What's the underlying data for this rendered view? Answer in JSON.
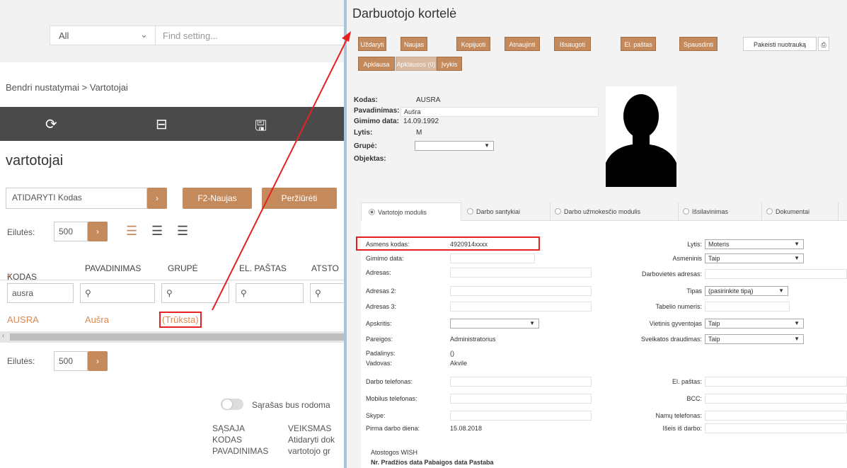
{
  "left": {
    "search": {
      "scope": "All",
      "placeholder": "Find setting..."
    },
    "breadcrumb": "Bendri nustatymai > Vartotojai",
    "page_title": "vartotojai",
    "open_field": "ATIDARYTI Kodas",
    "f2_label": "F2-Naujas",
    "view_label": "Peržiūrėti",
    "rows_label": "Eilutės:",
    "rows_value": "500",
    "columns": [
      "KODAS",
      "PAVADINIMAS",
      "GRUPĖ",
      "EL. PAŠTAS",
      "ATSTO"
    ],
    "filter_value": "ausra",
    "row": {
      "kodas": "AUSRA",
      "pavadinimas": "Aušra",
      "grupe": "(Trūksta)"
    },
    "toggle_text": "Sąrašas bus rodoma",
    "bottom": {
      "c1": [
        "SĄSAJA",
        "KODAS",
        "PAVADINIMAS"
      ],
      "c2": [
        "VEIKSMAS",
        "Atidaryti dok",
        "vartotojo gr"
      ]
    }
  },
  "right": {
    "title": "Darbuotojo kortelė",
    "buttons_row1": [
      "Uždaryti",
      "Naujas",
      "Kopijuoti",
      "Atnaujinti",
      "Išsaugoti",
      "El. paštas",
      "Spausdinti"
    ],
    "change_photo": "Pakeisti nuotrauką",
    "buttons_row2": [
      "Apklausa",
      "Apklausos (0)",
      "Įvykis"
    ],
    "info": {
      "kodas_label": "Kodas:",
      "kodas": "AUSRA",
      "pav_label": "Pavadinimas:",
      "pav": "Aušra",
      "gim_label": "Gimimo data:",
      "gim": "14.09.1992",
      "lytis_label": "Lytis:",
      "lytis": "M",
      "grupe_label": "Grupė:",
      "obj_label": "Objektas:"
    },
    "tabs": [
      "Vartotojo modulis",
      "Darbo santykiai",
      "Darbo užmokesčio modulis",
      "Išsilavinimas",
      "Dokumentai"
    ],
    "form_left": {
      "asmens_label": "Asmens kodas:",
      "asmens": "4920914xxxx",
      "gimimo": "Gimimo data:",
      "adresas": "Adresas:",
      "adresas2": "Adresas 2:",
      "adresas3": "Adresas 3:",
      "apskritis": "Apskritis:",
      "pareigos_label": "Pareigos:",
      "pareigos": "Administratorius",
      "padalinys_label": "Padalinys:",
      "padalinys": "()",
      "vadovas_label": "Vadovas:",
      "vadovas": "Akvile",
      "darbo_tel": "Darbo telefonas:",
      "mob_tel": "Mobilus telefonas:",
      "skype": "Skype:",
      "pirma_label": "Pirma darbo diena:",
      "pirma": "15.08.2018",
      "atostogos": "Atostogos WISH",
      "cols": "Nr. Pradžios data Pabaigos data Pastaba"
    },
    "form_right": {
      "lytis_label": "Lytis:",
      "lytis": "Moteris",
      "asmeninis_label": "Asmeninis",
      "asmeninis": "Taip",
      "darbov": "Darbovietės adresas:",
      "tipas_label": "Tipas",
      "tipas": "(pasirinkite tipą)",
      "tabelio": "Tabelio numeris:",
      "vietinis_label": "Vietinis gyventojas",
      "vietinis": "Taip",
      "sveikatos_label": "Sveikatos draudimas:",
      "sveikatos": "Taip",
      "el_pastas": "El. paštas:",
      "bcc": "BCC:",
      "namu": "Namų telefonas:",
      "iseis": "Išeis iš darbo:"
    }
  },
  "colors": {
    "accent": "#c48a5c",
    "highlight": "#e52222",
    "link": "#d98a55",
    "toolbar": "#4a4a4a"
  }
}
